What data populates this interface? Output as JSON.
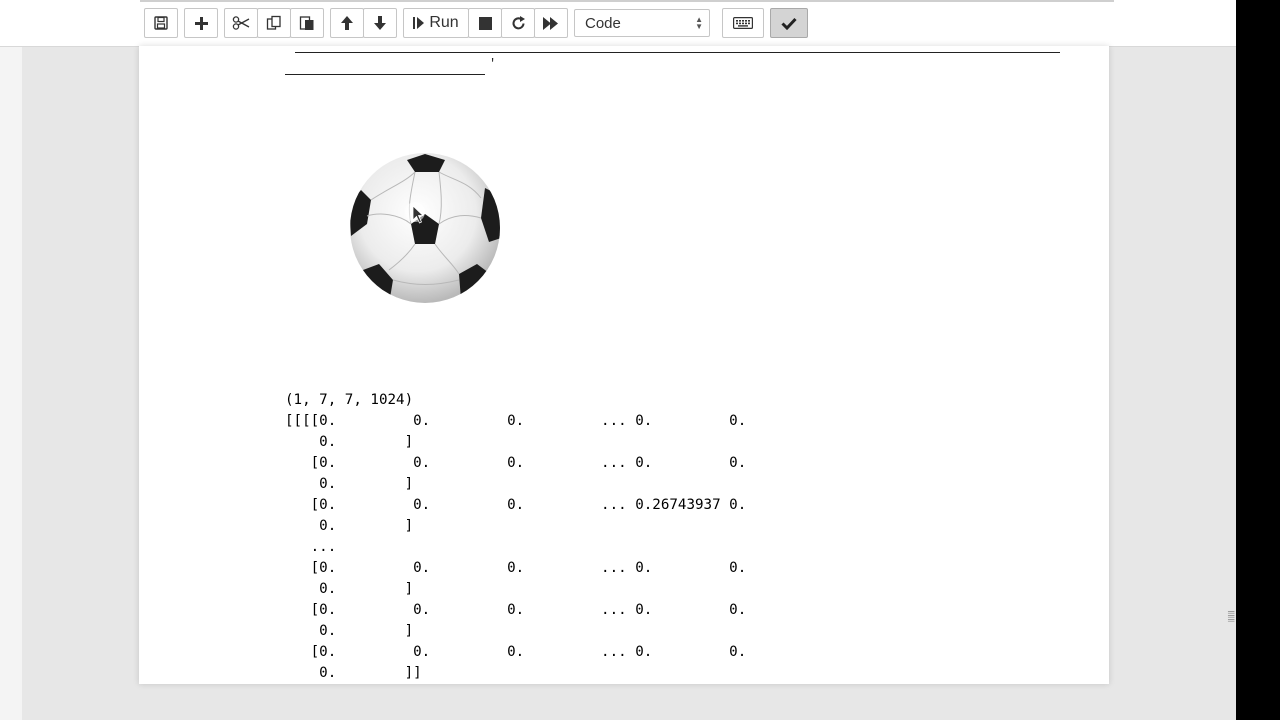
{
  "toolbar": {
    "groups": [
      [
        {
          "name": "save",
          "icon": "save-icon"
        }
      ],
      [
        {
          "name": "insert-cell-below",
          "icon": "plus-icon"
        }
      ],
      [
        {
          "name": "cut",
          "icon": "scissors-icon"
        },
        {
          "name": "copy",
          "icon": "copy-icon"
        },
        {
          "name": "paste",
          "icon": "paste-icon"
        }
      ],
      [
        {
          "name": "move-up",
          "icon": "arrow-up-icon"
        },
        {
          "name": "move-down",
          "icon": "arrow-down-icon"
        }
      ],
      [
        {
          "name": "run",
          "icon": "step-forward-icon"
        },
        {
          "name": "interrupt",
          "icon": "stop-icon"
        },
        {
          "name": "restart",
          "icon": "restart-icon"
        },
        {
          "name": "restart-run-all",
          "icon": "fast-forward-icon"
        }
      ]
    ],
    "run_label": "Run",
    "cell_type": {
      "selected": "Code"
    },
    "command_palette_icon": "keyboard-icon",
    "checkpoint_icon": "check-icon"
  },
  "output": {
    "image_description_icon": "soccer-ball-image",
    "shape_text": "(1, 7, 7, 1024)",
    "array_lines": [
      "[[[[0.         0.         0.         ... 0.         0.",
      "    0.        ]",
      "   [0.         0.         0.         ... 0.         0.",
      "    0.        ]",
      "   [0.         0.         0.         ... 0.26743937 0.",
      "    0.        ]",
      "   ...",
      "   [0.         0.         0.         ... 0.         0.",
      "    0.        ]",
      "   [0.         0.         0.         ... 0.         0.",
      "    0.        ]",
      "   [0.         0.         0.         ... 0.         0.",
      "    0.        ]]"
    ]
  },
  "colors": {
    "toolbar_bg": "#ffffff",
    "page_bg": "#e7e7e7",
    "active_button": "#d4d4d4"
  }
}
